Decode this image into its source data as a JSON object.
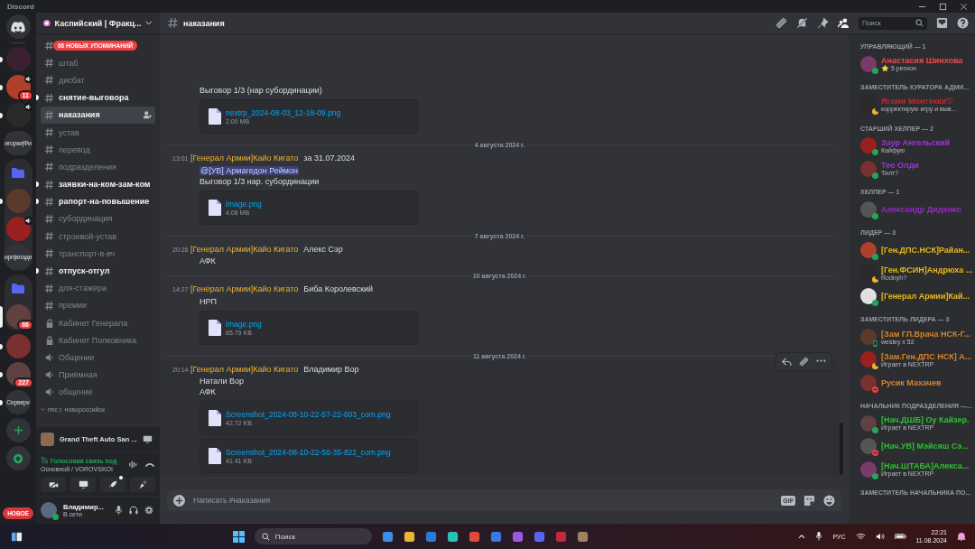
{
  "window": {
    "title": "Discord"
  },
  "servers": [
    {
      "kind": "home",
      "selected": false,
      "unread": false,
      "in_voice": false
    },
    {
      "kind": "image",
      "selected": false,
      "unread": true,
      "in_voice": false
    },
    {
      "kind": "image",
      "selected": false,
      "unread": true,
      "in_voice": true,
      "badge": "11"
    },
    {
      "kind": "image",
      "selected": false,
      "unread": true,
      "in_voice": true
    },
    {
      "kind": "text",
      "label": "игорки|Фи",
      "selected": false,
      "unread": false,
      "in_voice": false
    },
    {
      "kind": "folder",
      "children": [
        {
          "kind": "image",
          "selected": false,
          "unread": true,
          "in_voice": false
        },
        {
          "kind": "image",
          "selected": false,
          "unread": false,
          "in_voice": true
        },
        {
          "kind": "text",
          "label": "ирп|влади",
          "selected": false,
          "unread": false,
          "in_voice": false
        }
      ]
    },
    {
      "kind": "folder",
      "children": [
        {
          "kind": "image",
          "selected": true,
          "in_voice": false,
          "badge": "66"
        }
      ]
    },
    {
      "kind": "image",
      "selected": false,
      "unread": true,
      "in_voice": false
    },
    {
      "kind": "image",
      "selected": false,
      "unread": true,
      "in_voice": false,
      "badge": "227"
    },
    {
      "kind": "text",
      "label": "Серверv",
      "selected": false,
      "unread": true,
      "in_voice": false
    },
    {
      "kind": "add",
      "selected": false,
      "unread": false,
      "in_voice": false
    },
    {
      "kind": "explore",
      "selected": false,
      "unread": false,
      "in_voice": false
    }
  ],
  "new_button": "НОВОЕ",
  "sidebar": {
    "server_name": "Каспийский | Фракц...",
    "mentions_banner": "66 НОВЫХ УПОМИНАНИЙ",
    "channels": [
      {
        "kind": "text",
        "name": "штаб",
        "unread": false,
        "selected": false
      },
      {
        "kind": "text",
        "name": "дисбат",
        "unread": false,
        "selected": false
      },
      {
        "kind": "text",
        "name": "снятие-выговора",
        "unread": true,
        "selected": false
      },
      {
        "kind": "text",
        "name": "наказания",
        "unread": false,
        "selected": true
      },
      {
        "kind": "text",
        "name": "устав",
        "unread": false,
        "selected": false
      },
      {
        "kind": "text",
        "name": "перевод",
        "unread": false,
        "selected": false
      },
      {
        "kind": "text",
        "name": "подразделения",
        "unread": false,
        "selected": false
      },
      {
        "kind": "text",
        "name": "заявки-на-ком-зам-ком",
        "unread": true,
        "selected": false
      },
      {
        "kind": "text",
        "name": "рапорт-на-повышение",
        "unread": true,
        "selected": false
      },
      {
        "kind": "text",
        "name": "субординация",
        "unread": false,
        "selected": false
      },
      {
        "kind": "text",
        "name": "строевой-устав",
        "unread": false,
        "selected": false
      },
      {
        "kind": "text",
        "name": "транспорт-в-вч",
        "unread": false,
        "selected": false
      },
      {
        "kind": "text",
        "name": "отпуск-отгул",
        "unread": true,
        "selected": false
      },
      {
        "kind": "text",
        "name": "для-стажера",
        "unread": false,
        "selected": false
      },
      {
        "kind": "text",
        "name": "премии",
        "unread": false,
        "selected": false
      },
      {
        "kind": "locked",
        "name": "Кабинет Генерала",
        "unread": false,
        "selected": false
      },
      {
        "kind": "locked",
        "name": "Кабинет Полковника",
        "unread": false,
        "selected": false
      },
      {
        "kind": "voice",
        "name": "Общение",
        "unread": false,
        "selected": false
      },
      {
        "kind": "voice",
        "name": "Приёмная",
        "unread": false,
        "selected": false
      },
      {
        "kind": "voice",
        "name": "общение",
        "unread": false,
        "selected": false
      }
    ],
    "category": "ппс г. новороссийск",
    "activity": "Grand Theft Auto San ...",
    "voice": {
      "status": "Голосовая связь под",
      "channel": "Основной / VOROVSKOI"
    },
    "user": {
      "name": "Владимир...",
      "status_text": "В сети",
      "status": {
        "kind": "online"
      }
    }
  },
  "channel": {
    "name": "наказания",
    "search_placeholder": "Поиск"
  },
  "messages": [
    {
      "kind": "continuation",
      "lines": [
        {
          "kind": "text",
          "text": "Выговор 1/3 (нар субординации)"
        }
      ],
      "attachments": [
        {
          "name": "nextrp_2024-08-03_12-18-09.png",
          "size": "2.00 MB"
        }
      ],
      "hovered": false
    },
    {
      "kind": "divider",
      "date": "4 августа 2024 г."
    },
    {
      "kind": "message",
      "time": "13:01",
      "author": "[Генерал Армии]Кайо Кигато",
      "first_line": "за 31.07.2024",
      "lines": [
        {
          "kind": "mention",
          "text": "@[УВ] Армагедон Реймон"
        },
        {
          "kind": "text",
          "text": "Выговор 1/3 нар. субординации"
        }
      ],
      "attachments": [
        {
          "name": "image.png",
          "size": "4.08 MB"
        }
      ],
      "hovered": false
    },
    {
      "kind": "divider",
      "date": "7 августа 2024 г."
    },
    {
      "kind": "message",
      "time": "20:26",
      "author": "[Генерал Армии]Кайо Кигато",
      "first_line": "Алекс Сэр",
      "lines": [
        {
          "kind": "text",
          "text": "АФК"
        }
      ],
      "hovered": false
    },
    {
      "kind": "divider",
      "date": "10 августа 2024 г."
    },
    {
      "kind": "message",
      "time": "14:27",
      "author": "[Генерал Армии]Кайо Кигато",
      "first_line": "Биба Королевский",
      "lines": [
        {
          "kind": "text",
          "text": "НРП"
        }
      ],
      "attachments": [
        {
          "name": "image.png",
          "size": "65.79 KB"
        }
      ],
      "hovered": false
    },
    {
      "kind": "divider",
      "date": "11 августа 2024 г."
    },
    {
      "kind": "message",
      "time": "20:14",
      "author": "[Генерал Армии]Кайо Кигато",
      "first_line": "Владимир Вор",
      "lines": [
        {
          "kind": "text",
          "text": "Натали Вор"
        },
        {
          "kind": "text",
          "text": "АФК"
        }
      ],
      "attachments": [
        {
          "name": "Screenshot_2024-08-10-22-57-22-603_com.png",
          "size": "42.72 KB"
        },
        {
          "name": "Screenshot_2024-08-10-22-56-35-822_com.png",
          "size": "41.41 KB"
        }
      ],
      "hovered": true
    }
  ],
  "composer": {
    "placeholder": "Написать #наказания",
    "gif_label": "GIF"
  },
  "member_groups": [
    {
      "title": "УПРАВЛЯЮЩИЙ — 1",
      "members": [
        {
          "name": "Анастасия Шинхова",
          "activity": "⭐ 5 регион",
          "status": {
            "kind": "online"
          },
          "color": "#f04a4a"
        }
      ]
    },
    {
      "title": "ЗАМЕСТИТЕЛЬ КУРАТОРА АДМИ...",
      "members": [
        {
          "name": "Ягами Монтекки♡",
          "activity": "корректирую игру и выв...",
          "status": {
            "kind": "idle"
          },
          "color": "#c4282d"
        }
      ]
    },
    {
      "title": "СТАРШИЙ ХЕЛПЕР — 2",
      "members": [
        {
          "name": "Заур Ангельский",
          "activity": "Кайфую",
          "status": {
            "kind": "online"
          },
          "color": "#a52ee0"
        },
        {
          "name": "Тео Олди",
          "activity": "Тилт?",
          "status": {
            "kind": "online"
          },
          "color": "#a52ee0"
        }
      ]
    },
    {
      "title": "ХЕЛПЕР — 1",
      "members": [
        {
          "name": "Александр Диденко",
          "status": {
            "kind": "online"
          },
          "color": "#9b27c8"
        }
      ]
    },
    {
      "title": "ЛИДЕР — 3",
      "members": [
        {
          "name": "[Ген.ДПС.НСК]Райан...",
          "status": {
            "kind": "online"
          },
          "color": "#e8b81a"
        },
        {
          "name": "[Ген.ФСИН]Андрюха ...",
          "activity": "Rodnyh?",
          "status": {
            "kind": "idle"
          },
          "color": "#e8b81a"
        },
        {
          "name": "[Генерал Армии]Кай...",
          "status": {
            "kind": "online"
          },
          "color": "#e8b81a"
        }
      ]
    },
    {
      "title": "ЗАМЕСТИТЕЛЬ ЛИДЕРА — 3",
      "members": [
        {
          "name": "[Зам ГЛ.Врача НСК-Г...",
          "activity": "wesley x 52",
          "status": {
            "kind": "mobile"
          },
          "color": "#d9822b"
        },
        {
          "name": "[Зам.Ген.ДПС НСК] А...",
          "activity": "Играет в NEXTRP",
          "status": {
            "kind": "idle"
          },
          "color": "#d9822b"
        },
        {
          "name": "Русик Махачев",
          "status": {
            "kind": "dnd"
          },
          "color": "#d9822b"
        }
      ]
    },
    {
      "title": "НАЧАЛЬНИК ПОДРАЗДЕЛЕНИЯ —...",
      "members": [
        {
          "name": "[Нач.ДШБ] Оу Кайзер.",
          "activity": "Играет в NEXTRP",
          "status": {
            "kind": "online"
          },
          "color": "#2ec02e"
        },
        {
          "name": "[Нач.УВ] Мэйсяш Сэ...",
          "status": {
            "kind": "dnd"
          },
          "color": "#2ec02e"
        },
        {
          "name": "[Нач.ШТАБА]Алекса...",
          "activity": "Играет в NEXTRP",
          "status": {
            "kind": "online"
          },
          "color": "#2ec02e"
        }
      ]
    },
    {
      "title": "ЗАМЕСТИТЕЛЬ НАЧАЛЬНИКА ПО..."
    }
  ],
  "taskbar": {
    "search_placeholder": "Поиск",
    "language": "РУС",
    "time": "22:21",
    "date": "11.08.2024"
  }
}
